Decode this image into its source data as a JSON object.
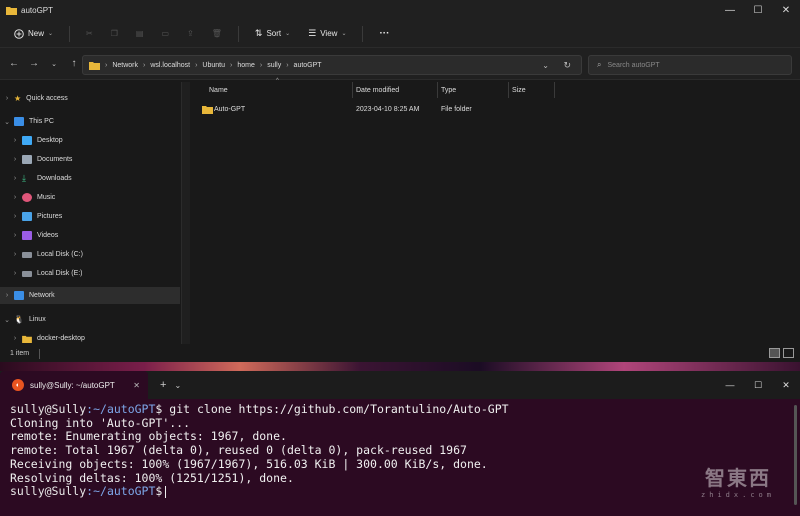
{
  "explorer": {
    "window_title": "autoGPT",
    "window_controls": {
      "minimize": "—",
      "maximize": "☐",
      "close": "✕"
    },
    "toolbar": {
      "new_label": "New",
      "sort_label": "Sort",
      "view_label": "View",
      "more_label": "···"
    },
    "address": {
      "crumbs": [
        "Network",
        "wsl.localhost",
        "Ubuntu",
        "home",
        "sully",
        "autoGPT"
      ]
    },
    "search": {
      "placeholder": "Search autoGPT"
    },
    "nav": {
      "quick_access": "Quick access",
      "this_pc": "This PC",
      "desktop": "Desktop",
      "documents": "Documents",
      "downloads": "Downloads",
      "music": "Music",
      "pictures": "Pictures",
      "videos": "Videos",
      "local_c": "Local Disk (C:)",
      "local_e": "Local Disk (E:)",
      "network": "Network",
      "linux": "Linux",
      "docker_desktop": "docker-desktop"
    },
    "columns": {
      "name": "Name",
      "date": "Date modified",
      "type": "Type",
      "size": "Size"
    },
    "files": [
      {
        "name": "Auto-GPT",
        "date": "2023-04-10 8:25 AM",
        "type": "File folder",
        "size": ""
      }
    ],
    "status": {
      "count": "1 item"
    }
  },
  "terminal": {
    "tab_title": "sully@Sully: ~/autoGPT",
    "tab_close": "✕",
    "new_tab": "+",
    "dropdown": "⌄",
    "window_controls": {
      "minimize": "—",
      "maximize": "☐",
      "close": "✕"
    },
    "prompt_user": "sully@Sully",
    "prompt_path": ":~/autoGPT",
    "prompt_end": "$",
    "command": " git clone https://github.com/Torantulino/Auto-GPT",
    "output": [
      "Cloning into 'Auto-GPT'...",
      "remote: Enumerating objects: 1967, done.",
      "remote: Total 1967 (delta 0), reused 0 (delta 0), pack-reused 1967",
      "Receiving objects: 100% (1967/1967), 516.03 KiB | 300.00 KiB/s, done.",
      "Resolving deltas: 100% (1251/1251), done."
    ]
  },
  "watermark": {
    "big": "智東西",
    "small": "zhidx.com"
  },
  "colors": {
    "terminal_bg": "#2c0a22",
    "explorer_bg": "#191919",
    "folder": "#e8b73a",
    "ubuntu_orange": "#e95420",
    "prompt_path": "#7da6e8"
  }
}
